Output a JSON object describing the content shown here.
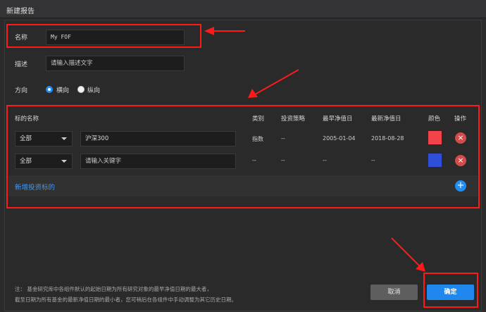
{
  "window": {
    "title": "新建报告"
  },
  "form": {
    "name_label": "名称",
    "name_value": "My FOF",
    "desc_label": "描述",
    "desc_placeholder": "请输入描述文字",
    "orientation_label": "方向",
    "orientation_options": [
      {
        "label": "横向",
        "selected": true
      },
      {
        "label": "纵向",
        "selected": false
      }
    ]
  },
  "table": {
    "headers": [
      "标的名称",
      "类别",
      "投资策略",
      "最早净值日",
      "最新净值日",
      "颜色",
      "操作"
    ],
    "rows": [
      {
        "scope": "全部",
        "name": "沪深300",
        "category": "指数",
        "strategy": "--",
        "earliest": "2005-01-04",
        "latest": "2018-08-28",
        "color": "#f2424a"
      },
      {
        "scope": "全部",
        "name_placeholder": "请输入关键字",
        "category": "--",
        "strategy": "--",
        "earliest": "--",
        "latest": "--",
        "color": "#2f4fd9"
      }
    ],
    "add_label": "新增投资标的"
  },
  "footer": {
    "note_line1": "注：  基金研究库中各组件默认的起始日期为所有研究对象的最早净值日期的最大者，",
    "note_line2": "截至日期为所有基金的最新净值日期的最小者，您可稍后在各组件中手动调整为其它历史日期。",
    "cancel_label": "取消",
    "ok_label": "确定"
  },
  "accent": "#1f87ee",
  "highlight": "#ff1a1a"
}
